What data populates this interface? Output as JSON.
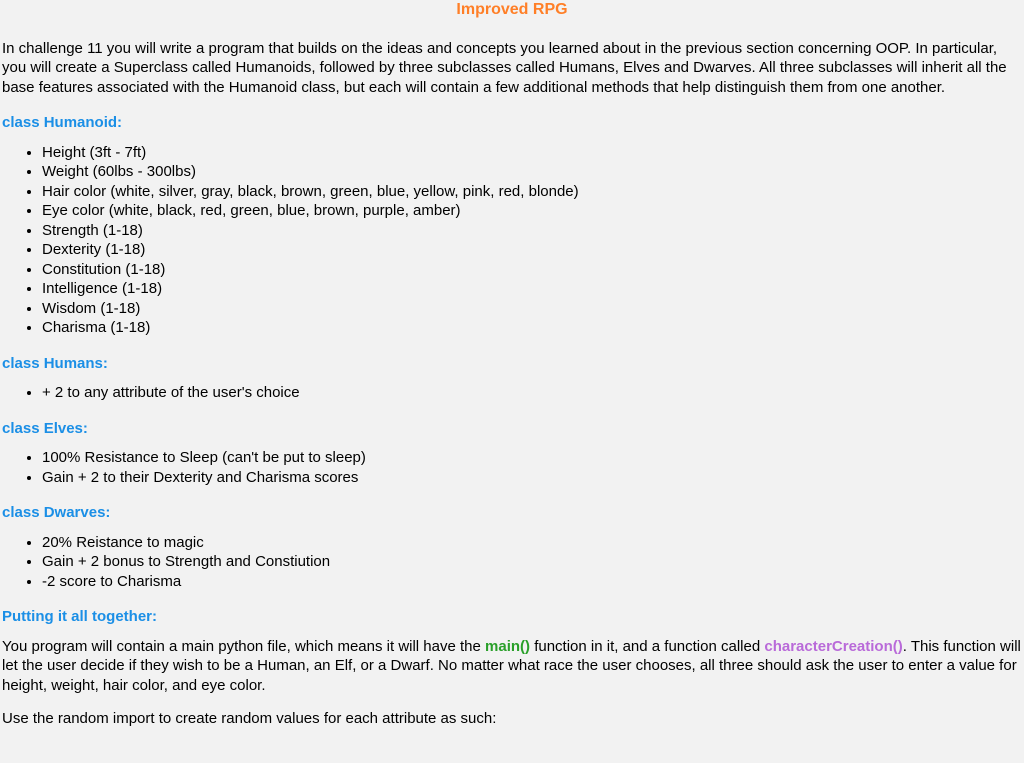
{
  "title": "Improved RPG",
  "intro": "In challenge 11 you will write a program that builds on the ideas and concepts you learned about in the previous section concerning OOP.  In particular, you will create a Superclass called Humanoids, followed by three subclasses called Humans, Elves and Dwarves.  All three subclasses will inherit all the base features associated with the Humanoid class, but each will contain a few additional methods that help distinguish them from one another.",
  "sections": {
    "humanoid": {
      "heading": "class Humanoid:",
      "items": [
        "Height    (3ft - 7ft)",
        "Weight   (60lbs - 300lbs)",
        "Hair color  (white, silver, gray, black, brown, green, blue, yellow, pink, red, blonde)",
        "Eye color   (white, black, red, green, blue, brown, purple, amber)",
        "Strength    (1-18)",
        "Dexterity   (1-18)",
        "Constitution (1-18)",
        "Intelligence  (1-18)",
        "Wisdom     (1-18)",
        "Charisma   (1-18)"
      ]
    },
    "humans": {
      "heading": "class Humans:",
      "items": [
        "+ 2 to any attribute of the user's choice"
      ]
    },
    "elves": {
      "heading": "class Elves:",
      "items": [
        "100% Resistance to Sleep (can't be put to sleep)",
        "Gain + 2 to their Dexterity and Charisma scores"
      ]
    },
    "dwarves": {
      "heading": "class Dwarves:",
      "items": [
        "20% Reistance to magic",
        "Gain + 2 bonus to Strength and Constiution",
        "-2 score to Charisma"
      ]
    },
    "together": {
      "heading": "Putting it all together:",
      "p1_a": "You program will contain a main python file, which means it will have the ",
      "fn1": "main()",
      "p1_b": " function in it, and a function called ",
      "fn2": "characterCreation()",
      "p1_c": ".  This function will let the user decide if they wish to be a Human, an Elf, or a Dwarf.  No matter what race the user chooses, all three should ask the user to enter a value for height, weight, hair color, and eye color.",
      "p2": "Use the random import to create random values for each attribute as such:"
    }
  }
}
